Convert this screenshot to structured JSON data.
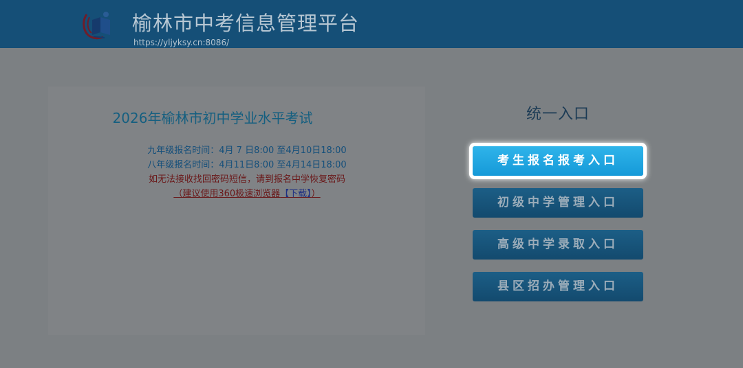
{
  "header": {
    "title": "榆林市中考信息管理平台",
    "url": "https://yljyksy.cn:8086/",
    "logo_icon": "book-globe-logo-icon"
  },
  "notice": {
    "title": "2026年榆林市初中学业水平考试",
    "grade9_schedule": "九年级报名时间：4月 7 日8:00 至4月10日18:00",
    "grade8_schedule": "八年级报名时间：4月11日8:00 至4月14日18:00",
    "password_hint": "如无法接收找回密码短信，请到报名中学恢复密码",
    "browser_hint_prefix": "（建议使用360极速浏览器",
    "download_link": "【下载】",
    "browser_hint_suffix": "）"
  },
  "entry": {
    "heading": "统一入口",
    "buttons": [
      {
        "label": "考生报名报考入口",
        "active": true
      },
      {
        "label": "初级中学管理入口",
        "active": false
      },
      {
        "label": "高级中学录取入口",
        "active": false
      },
      {
        "label": "县区招办管理入口",
        "active": false
      }
    ]
  },
  "colors": {
    "header_bg": "#154f77",
    "page_bg": "#7c8083",
    "active_button": "#1fa6e0",
    "button": "#17557c",
    "alert_text": "#6a1718"
  }
}
